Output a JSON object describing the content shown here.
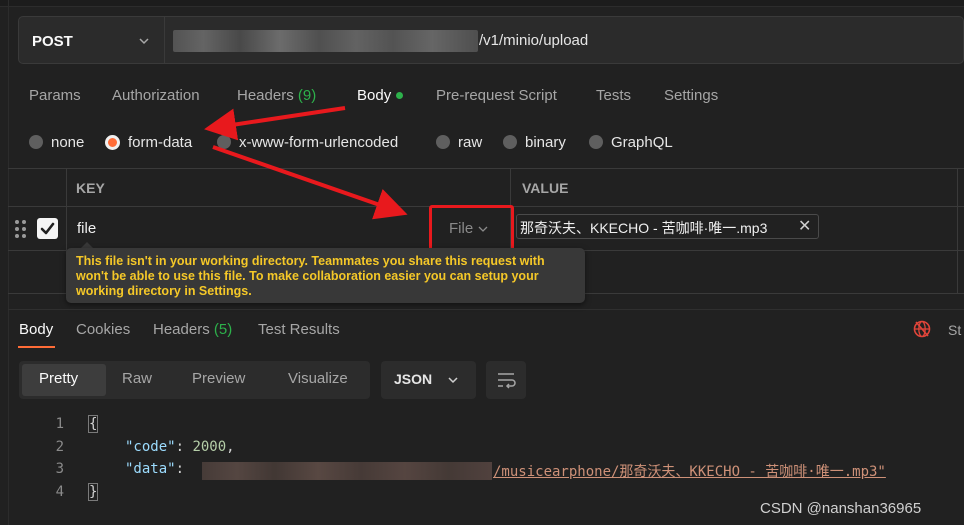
{
  "request": {
    "method": "POST",
    "url_suffix": "/v1/minio/upload"
  },
  "req_tabs": [
    {
      "label": "Params"
    },
    {
      "label": "Authorization"
    },
    {
      "label": "Headers",
      "count": "(9)"
    },
    {
      "label": "Body"
    },
    {
      "label": "Pre-request Script"
    },
    {
      "label": "Tests"
    },
    {
      "label": "Settings"
    }
  ],
  "body_types": [
    {
      "label": "none"
    },
    {
      "label": "form-data"
    },
    {
      "label": "x-www-form-urlencoded"
    },
    {
      "label": "raw"
    },
    {
      "label": "binary"
    },
    {
      "label": "GraphQL"
    }
  ],
  "table": {
    "headers": {
      "key": "KEY",
      "value": "VALUE"
    },
    "row": {
      "key": "file",
      "type": "File",
      "value": "那奇沃夫、KKECHO - 苦咖啡·唯一.mp3"
    }
  },
  "tooltip": "This file isn't in your working directory. Teammates you share this request with won't be able to use this file. To make collaboration easier you can setup your working directory in Settings.",
  "response": {
    "tabs": [
      {
        "label": "Body"
      },
      {
        "label": "Cookies"
      },
      {
        "label": "Headers",
        "count": "(5)"
      },
      {
        "label": "Test Results"
      }
    ],
    "status_partial": "St",
    "view_modes": [
      {
        "label": "Pretty"
      },
      {
        "label": "Raw"
      },
      {
        "label": "Preview"
      },
      {
        "label": "Visualize"
      }
    ],
    "format": "JSON",
    "code": {
      "line_numbers": [
        "1",
        "2",
        "3",
        "4"
      ],
      "open_brace": "{",
      "close_brace": "}",
      "code_key": "\"code\"",
      "code_value": "2000",
      "data_key": "\"data\"",
      "data_value_visible": "/musicearphone/那奇沃夫、KKECHO - 苦咖啡·唯一.mp3\""
    }
  },
  "watermark": "CSDN @nanshan36965",
  "colors": {
    "accent": "#ff6c37",
    "green": "#2db14b",
    "annotation_red": "#e8191d",
    "warning_text": "#f5c828"
  }
}
